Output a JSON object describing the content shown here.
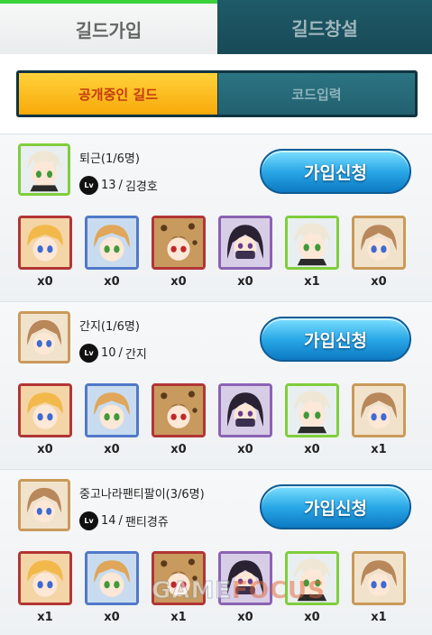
{
  "tabs": {
    "join": "길드가입",
    "create": "길드창설"
  },
  "subtabs": {
    "public": "공개중인 길드",
    "code": "코드입력"
  },
  "join_button_label": "가입신청",
  "lv_badge": "Lv",
  "guilds": [
    {
      "name": "퇴근(1/6명)",
      "level": "13",
      "leader": "김경호",
      "members": [
        {
          "count": "x0"
        },
        {
          "count": "x0"
        },
        {
          "count": "x0"
        },
        {
          "count": "x0"
        },
        {
          "count": "x1"
        },
        {
          "count": "x0"
        }
      ]
    },
    {
      "name": "간지(1/6명)",
      "level": "10",
      "leader": "간지",
      "members": [
        {
          "count": "x0"
        },
        {
          "count": "x0"
        },
        {
          "count": "x0"
        },
        {
          "count": "x0"
        },
        {
          "count": "x0"
        },
        {
          "count": "x1"
        }
      ]
    },
    {
      "name": "중고나라팬티팔이(3/6명)",
      "level": "14",
      "leader": "팬티경쥬",
      "members": [
        {
          "count": "x1"
        },
        {
          "count": "x0"
        },
        {
          "count": "x1"
        },
        {
          "count": "x0"
        },
        {
          "count": "x0"
        },
        {
          "count": "x1"
        }
      ]
    }
  ],
  "watermark": {
    "part1": "GAME",
    "part2": "FOCUS"
  },
  "colors": {
    "active_tab_indicator": "#3bd13b",
    "public_tab": "#f8a90a",
    "join_button": "#2aa8e8"
  }
}
